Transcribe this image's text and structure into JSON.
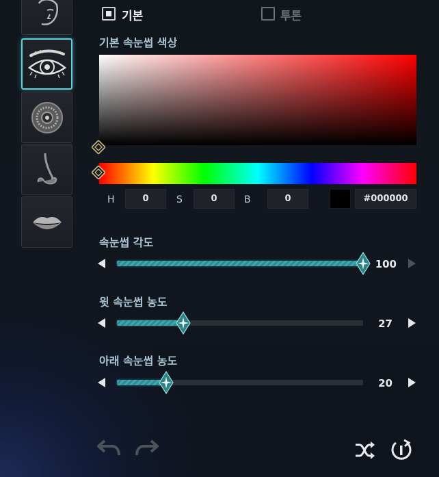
{
  "tabs": [
    {
      "label": "기본",
      "checked": true
    },
    {
      "label": "투톤",
      "checked": false
    }
  ],
  "sidebar": {
    "items": [
      {
        "name": "face",
        "icon": "face-icon",
        "active": false
      },
      {
        "name": "eye",
        "icon": "eye-icon",
        "active": true
      },
      {
        "name": "pupil",
        "icon": "iris-icon",
        "active": false
      },
      {
        "name": "nose",
        "icon": "nose-icon",
        "active": false
      },
      {
        "name": "lips",
        "icon": "lips-icon",
        "active": false
      }
    ]
  },
  "color_section": {
    "title": "기본 속눈썹 색상",
    "h_label": "H",
    "h_value": "0",
    "s_label": "S",
    "s_value": "0",
    "b_label": "B",
    "b_value": "0",
    "hex": "#000000"
  },
  "sliders": [
    {
      "label": "속눈썹 각도",
      "value": 100,
      "max": 100,
      "display": "100"
    },
    {
      "label": "윗 속눈썹 농도",
      "value": 27,
      "max": 100,
      "display": "27"
    },
    {
      "label": "아래 속눈썹 농도",
      "value": 20,
      "max": 100,
      "display": "20"
    }
  ],
  "colors": {
    "accent": "#5fd0dd",
    "slider_fill": "#3fa6b0",
    "title": "#a9c6d4"
  },
  "bottom": {
    "icons": [
      "undo-icon",
      "redo-icon",
      "shuffle-icon",
      "reset-icon"
    ]
  }
}
